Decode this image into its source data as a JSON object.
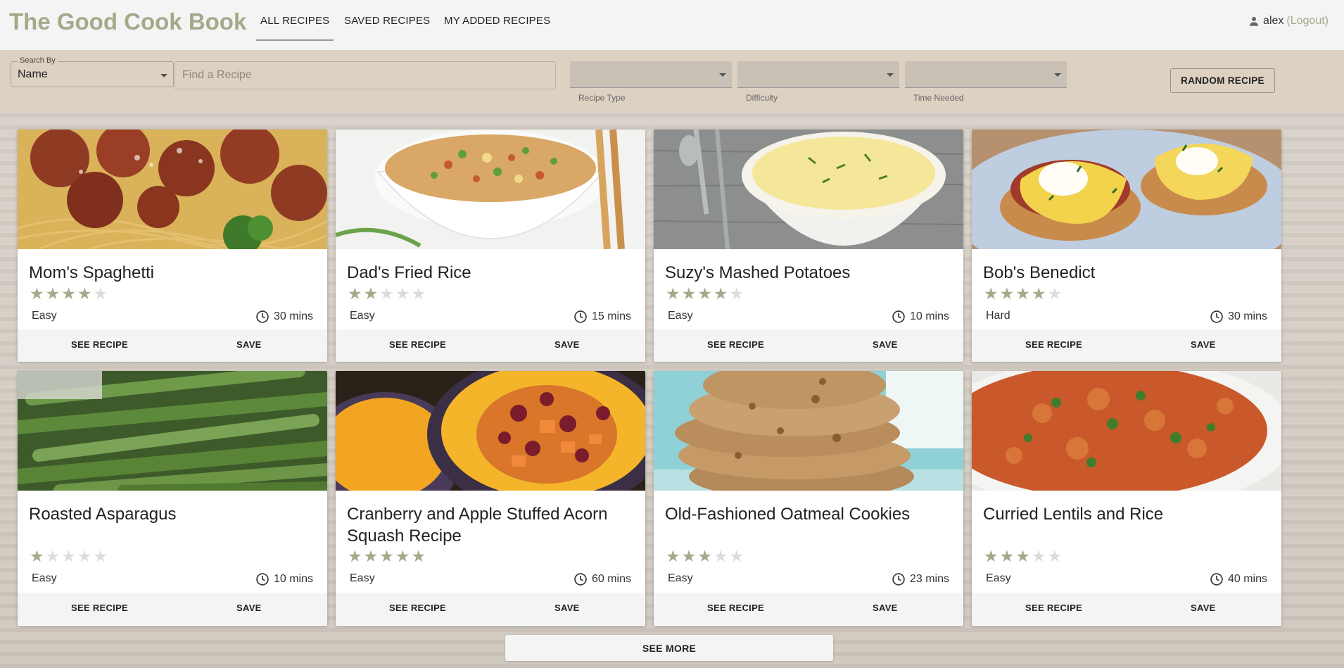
{
  "header": {
    "brand": "The Good Cook Book",
    "tabs": [
      {
        "label": "ALL RECIPES",
        "active": true
      },
      {
        "label": "SAVED RECIPES",
        "active": false
      },
      {
        "label": "MY ADDED RECIPES",
        "active": false
      }
    ],
    "user": {
      "name": "alex",
      "logout": "(Logout)"
    }
  },
  "filters": {
    "search_by_legend": "Search By",
    "search_by_value": "Name",
    "find_placeholder": "Find a Recipe",
    "recipe_type_label": "Recipe Type",
    "difficulty_label": "Difficulty",
    "time_needed_label": "Time Needed",
    "random_button": "RANDOM RECIPE"
  },
  "accent_color": "#a4a98a",
  "recipes": [
    {
      "title": "Mom's Spaghetti",
      "rating": 4,
      "difficulty": "Easy",
      "time": "30 mins",
      "see": "SEE RECIPE",
      "save": "SAVE"
    },
    {
      "title": "Dad's Fried Rice",
      "rating": 2,
      "difficulty": "Easy",
      "time": "15 mins",
      "see": "SEE RECIPE",
      "save": "SAVE"
    },
    {
      "title": "Suzy's Mashed Potatoes",
      "rating": 4,
      "difficulty": "Easy",
      "time": "10 mins",
      "see": "SEE RECIPE",
      "save": "SAVE"
    },
    {
      "title": "Bob's Benedict",
      "rating": 4,
      "difficulty": "Hard",
      "time": "30 mins",
      "see": "SEE RECIPE",
      "save": "SAVE"
    },
    {
      "title": "Roasted Asparagus",
      "rating": 1,
      "difficulty": "Easy",
      "time": "10 mins",
      "see": "SEE RECIPE",
      "save": "SAVE"
    },
    {
      "title": "Cranberry and Apple Stuffed Acorn Squash Recipe",
      "rating": 5,
      "difficulty": "Easy",
      "time": "60 mins",
      "see": "SEE RECIPE",
      "save": "SAVE"
    },
    {
      "title": "Old-Fashioned Oatmeal Cookies",
      "rating": 3,
      "difficulty": "Easy",
      "time": "23 mins",
      "see": "SEE RECIPE",
      "save": "SAVE"
    },
    {
      "title": "Curried Lentils and Rice",
      "rating": 3,
      "difficulty": "Easy",
      "time": "40 mins",
      "see": "SEE RECIPE",
      "save": "SAVE"
    }
  ],
  "see_more": "SEE MORE"
}
